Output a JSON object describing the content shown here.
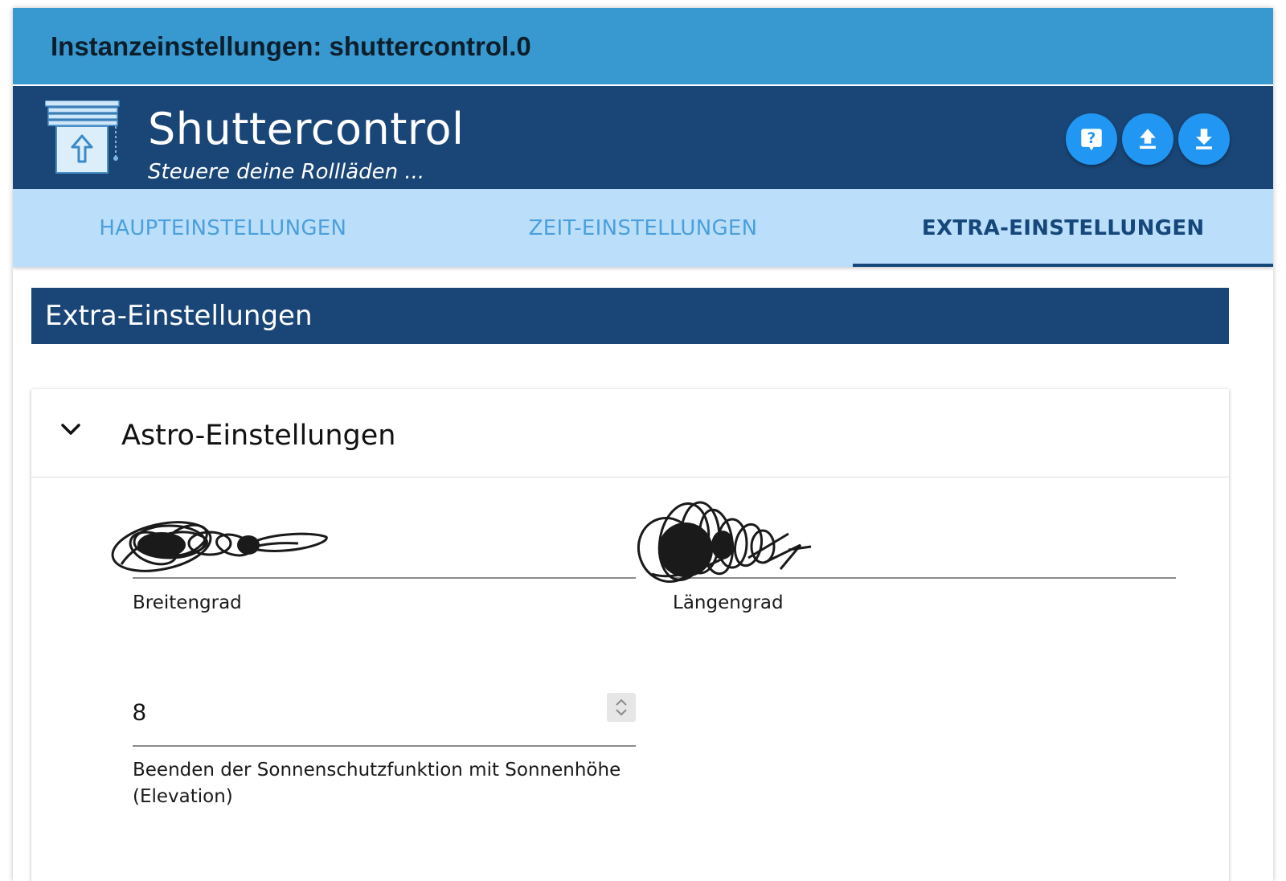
{
  "window": {
    "title": "Instanzeinstellungen: shuttercontrol.0"
  },
  "adapter": {
    "name": "Shuttercontrol",
    "subtitle": "Steuere deine Rollläden ...",
    "logo_icon": "shutter-logo-icon",
    "buttons": [
      {
        "name": "help-button",
        "icon": "help-icon"
      },
      {
        "name": "upload-button",
        "icon": "upload-icon"
      },
      {
        "name": "download-button",
        "icon": "download-icon"
      }
    ],
    "accent_color": "#2196f3",
    "header_color": "#1a4677"
  },
  "tabs": [
    {
      "label": "HAUPTEINSTELLUNGEN",
      "active": false
    },
    {
      "label": "ZEIT-EINSTELLUNGEN",
      "active": false
    },
    {
      "label": "EXTRA-EINSTELLUNGEN",
      "active": true
    }
  ],
  "section": {
    "title": "Extra-Einstellungen"
  },
  "astro_panel": {
    "title": "Astro-Einstellungen",
    "expanded": true,
    "fields": {
      "latitude": {
        "label": "Breitengrad",
        "value_redacted": true
      },
      "longitude": {
        "label": "Längengrad",
        "value_redacted": true
      },
      "elevation": {
        "value": "8",
        "label": "Beenden der Sonnenschutzfunktion mit Sonnenhöhe (Elevation)"
      }
    }
  }
}
